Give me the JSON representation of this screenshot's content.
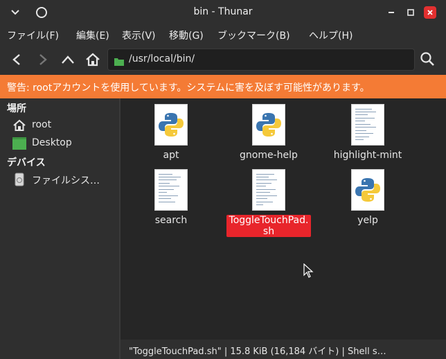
{
  "window": {
    "title": "bin - Thunar"
  },
  "menu": [
    "ファイル(F)",
    "編集(E)",
    "表示(V)",
    "移動(G)",
    "ブックマーク(B)",
    "ヘルプ(H)"
  ],
  "path": "/usr/local/bin/",
  "warning": "警告: rootアカウントを使用しています。システムに害を及ぼす可能性があります。",
  "sidebar": {
    "places_heading": "場所",
    "places": [
      {
        "label": "root",
        "icon": "home-icon"
      },
      {
        "label": "Desktop",
        "icon": "desktop-icon"
      }
    ],
    "devices_heading": "デバイス",
    "devices": [
      {
        "label": "ファイルシス…",
        "icon": "drive-icon"
      }
    ]
  },
  "files": [
    {
      "name": "apt",
      "type": "python"
    },
    {
      "name": "gnome-help",
      "type": "python"
    },
    {
      "name": "highlight-mint",
      "type": "text"
    },
    {
      "name": "search",
      "type": "text"
    },
    {
      "name": "ToggleTouchPad.sh",
      "type": "text",
      "selected": true,
      "name_line1": "ToggleTouchPad.",
      "name_line2": "sh"
    },
    {
      "name": "yelp",
      "type": "python"
    }
  ],
  "status": "\"ToggleTouchPad.sh\" | 15.8 KiB (16,184 バイト) | Shell s…",
  "colors": {
    "warning": "#f47b35",
    "selection": "#e8252b",
    "close": "#e23030"
  }
}
